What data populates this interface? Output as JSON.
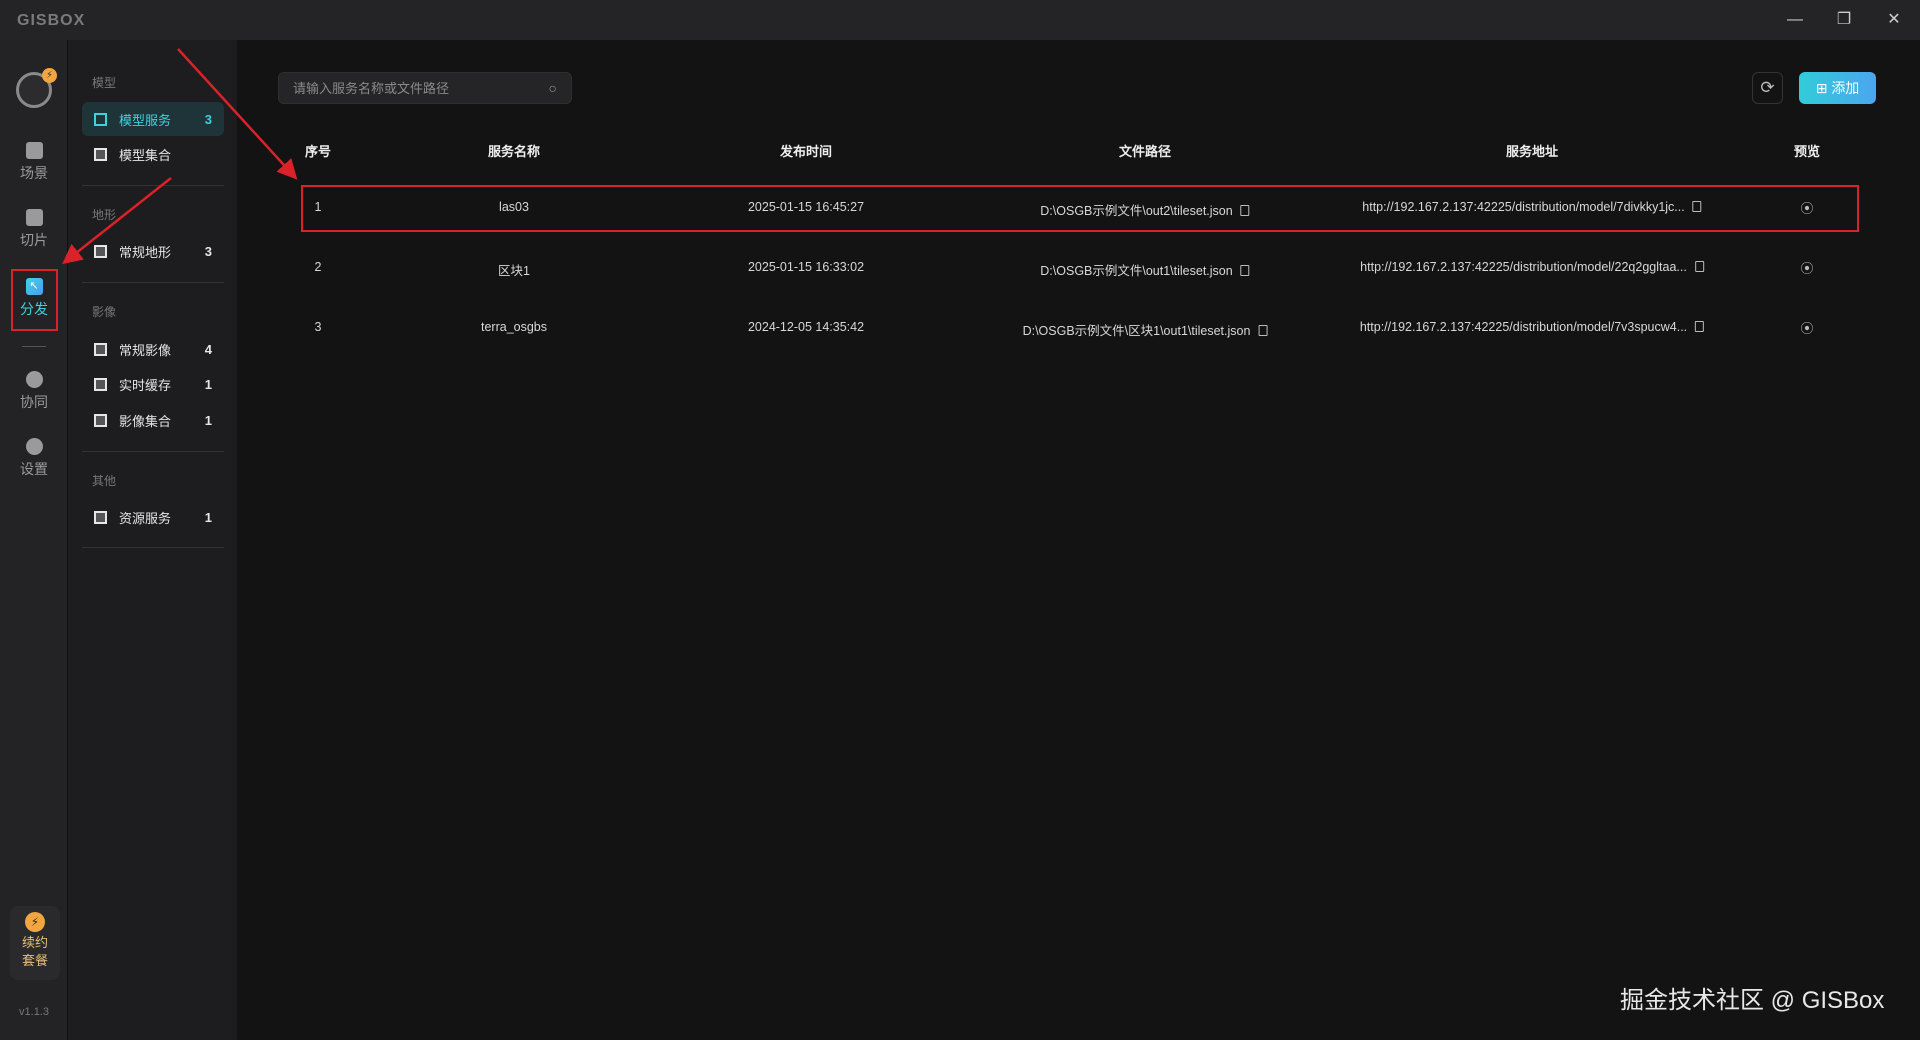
{
  "app": {
    "logo": "GISBOX",
    "minimize": "—",
    "restore": "❐",
    "close": "✕"
  },
  "rail": {
    "items": [
      {
        "label": "场景"
      },
      {
        "label": "切片"
      },
      {
        "label": "分发"
      },
      {
        "label": "协同"
      },
      {
        "label": "设置"
      }
    ],
    "renew": "续约\n套餐",
    "renew_line1": "续约",
    "renew_line2": "套餐",
    "version": "v1.1.3"
  },
  "sidebar": {
    "groups": [
      {
        "title": "模型",
        "items": [
          {
            "label": "模型服务",
            "count": "3"
          },
          {
            "label": "模型集合",
            "count": ""
          }
        ]
      },
      {
        "title": "地形",
        "items": [
          {
            "label": "常规地形",
            "count": "3"
          }
        ]
      },
      {
        "title": "影像",
        "items": [
          {
            "label": "常规影像",
            "count": "4"
          },
          {
            "label": "实时缓存",
            "count": "1"
          },
          {
            "label": "影像集合",
            "count": "1"
          }
        ]
      },
      {
        "title": "其他",
        "items": [
          {
            "label": "资源服务",
            "count": "1"
          }
        ]
      }
    ]
  },
  "search": {
    "placeholder": "请输入服务名称或文件路径",
    "value": ""
  },
  "toolbar": {
    "refresh": "⟳",
    "add": "添加"
  },
  "table": {
    "headers": [
      "序号",
      "服务名称",
      "发布时间",
      "文件路径",
      "服务地址",
      "预览"
    ],
    "rows": [
      {
        "no": "1",
        "name": "las03",
        "time": "2025-01-15 16:45:27",
        "path": "D:\\OSGB示例文件\\out2\\tileset.json",
        "url": "http://192.167.2.137:42225/distribution/model/7divkky1jc..."
      },
      {
        "no": "2",
        "name": "区块1",
        "time": "2025-01-15 16:33:02",
        "path": "D:\\OSGB示例文件\\out1\\tileset.json",
        "url": "http://192.167.2.137:42225/distribution/model/22q2ggltaa..."
      },
      {
        "no": "3",
        "name": "terra_osgbs",
        "time": "2024-12-05 14:35:42",
        "path": "D:\\OSGB示例文件\\区块1\\out1\\tileset.json",
        "url": "http://192.167.2.137:42225/distribution/model/7v3spucw4..."
      }
    ]
  },
  "watermark": "掘金技术社区 @ GISBox"
}
